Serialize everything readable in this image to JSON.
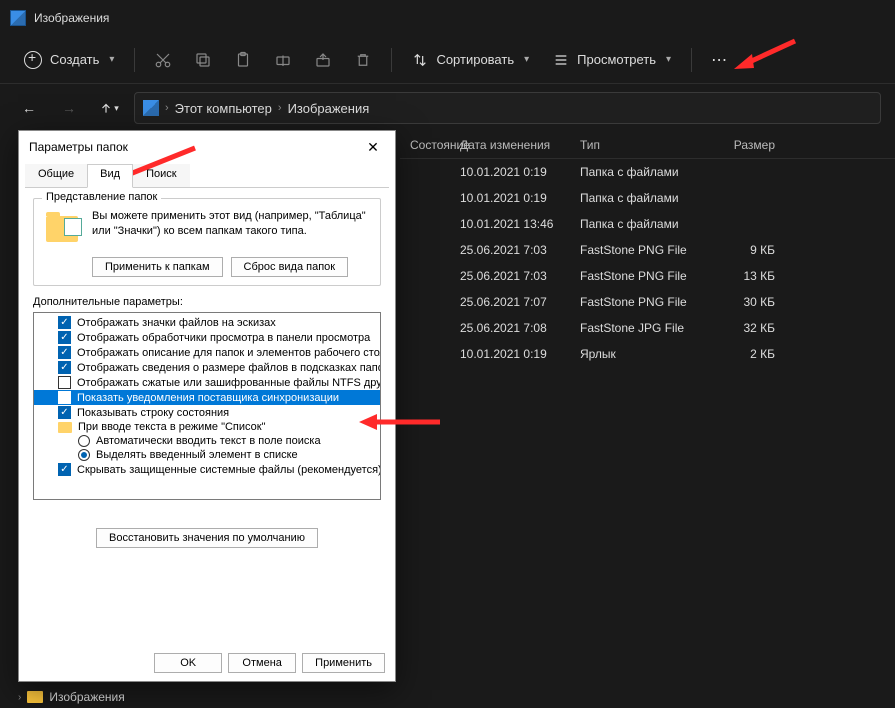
{
  "window": {
    "title": "Изображения"
  },
  "toolbar": {
    "create": "Создать",
    "sort": "Сортировать",
    "view": "Просмотреть"
  },
  "breadcrumb": {
    "seg1": "Этот компьютер",
    "seg2": "Изображения"
  },
  "columns": {
    "state": "Состояние",
    "date": "Дата изменения",
    "type": "Тип",
    "size": "Размер"
  },
  "rows": [
    {
      "date": "10.01.2021 0:19",
      "type": "Папка с файлами",
      "size": ""
    },
    {
      "date": "10.01.2021 0:19",
      "type": "Папка с файлами",
      "size": ""
    },
    {
      "date": "10.01.2021 13:46",
      "type": "Папка с файлами",
      "size": ""
    },
    {
      "date": "25.06.2021 7:03",
      "type": "FastStone PNG File",
      "size": "9 КБ"
    },
    {
      "date": "25.06.2021 7:03",
      "type": "FastStone PNG File",
      "size": "13 КБ"
    },
    {
      "date": "25.06.2021 7:07",
      "type": "FastStone PNG File",
      "size": "30 КБ"
    },
    {
      "date": "25.06.2021 7:08",
      "type": "FastStone JPG File",
      "size": "32 КБ"
    },
    {
      "date": "10.01.2021 0:19",
      "type": "Ярлык",
      "size": "2 КБ"
    }
  ],
  "dialog": {
    "title": "Параметры папок",
    "tabs": {
      "general": "Общие",
      "view": "Вид",
      "search": "Поиск"
    },
    "group_legend": "Представление папок",
    "group_text": "Вы можете применить этот вид (например, \"Таблица\" или \"Значки\") ко всем папкам такого типа.",
    "apply_to_folders": "Применить к папкам",
    "reset_folders": "Сброс вида папок",
    "advanced_label": "Дополнительные параметры:",
    "tree": [
      {
        "kind": "cb",
        "checked": true,
        "label": "Отображать значки файлов на эскизах"
      },
      {
        "kind": "cb",
        "checked": true,
        "label": "Отображать обработчики просмотра в панели просмотра"
      },
      {
        "kind": "cb",
        "checked": true,
        "label": "Отображать описание для папок и элементов рабочего стола"
      },
      {
        "kind": "cb",
        "checked": true,
        "label": "Отображать сведения о размере файлов в подсказках папок"
      },
      {
        "kind": "cb",
        "checked": false,
        "label": "Отображать сжатые или зашифрованные файлы NTFS другим цветом"
      },
      {
        "kind": "cb",
        "checked": false,
        "label": "Показать уведомления поставщика синхронизации",
        "selected": true
      },
      {
        "kind": "cb",
        "checked": true,
        "label": "Показывать строку состояния"
      },
      {
        "kind": "folder",
        "label": "При вводе текста в режиме \"Список\""
      },
      {
        "kind": "rb",
        "checked": false,
        "indent": true,
        "label": "Автоматически вводить текст в поле поиска"
      },
      {
        "kind": "rb",
        "checked": true,
        "indent": true,
        "label": "Выделять введенный элемент в списке"
      },
      {
        "kind": "cb",
        "checked": true,
        "label": "Скрывать защищенные системные файлы (рекомендуется)"
      }
    ],
    "restore_defaults": "Восстановить значения по умолчанию",
    "ok": "OK",
    "cancel": "Отмена",
    "apply": "Применить"
  },
  "side_item": "Изображения"
}
